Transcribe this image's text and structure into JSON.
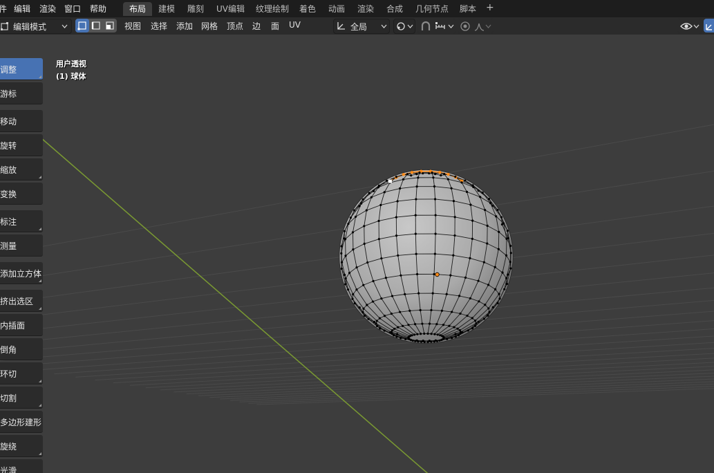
{
  "menubar": {
    "menus": [
      "件",
      "编辑",
      "渲染",
      "窗口",
      "帮助"
    ],
    "workspaces": [
      "布局",
      "建模",
      "雕刻",
      "UV编辑",
      "纹理绘制",
      "着色",
      "动画",
      "渲染",
      "合成",
      "几何节点",
      "脚本"
    ],
    "active_workspace": "布局",
    "add_workspace": "+"
  },
  "header": {
    "mode": "编辑模式",
    "menus": [
      "视图",
      "选择",
      "添加",
      "网格",
      "顶点",
      "边",
      "面",
      "UV"
    ],
    "transform_orientation": "全局"
  },
  "toolbar_tools": [
    "调整",
    "游标",
    "移动",
    "旋转",
    "缩放",
    "变换",
    "标注",
    "测量",
    "添加立方体",
    "挤出选区",
    "内插面",
    "倒角",
    "环切",
    "切割",
    "多边形建形",
    "旋绕",
    "光滑"
  ],
  "active_tool": "调整",
  "viewport": {
    "view_name": "用户透视",
    "object_label": "(1) 球体"
  },
  "colors": {
    "selected_edge": "#ff8c1a",
    "active_vertex": "#ffffff",
    "active_tool_bg": "#4772b3",
    "grid_y_axis": "#7a9a32"
  },
  "mesh": {
    "selected_edge_loop_ring": 3
  }
}
